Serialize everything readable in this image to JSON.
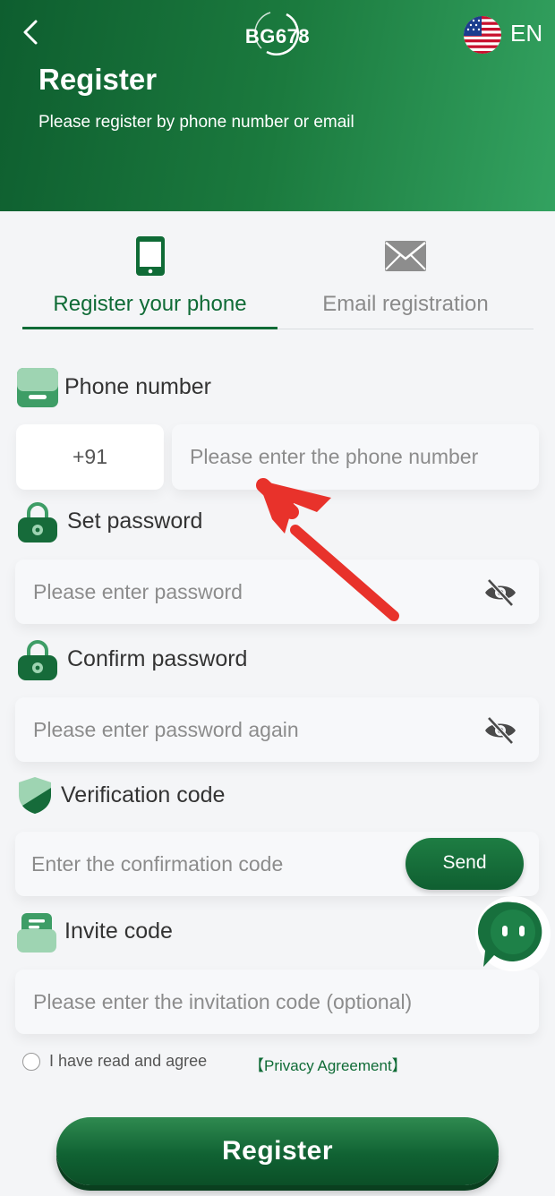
{
  "header": {
    "logo_text": "BG678",
    "language": "EN",
    "title": "Register",
    "subtitle": "Please register by phone number or email"
  },
  "tabs": [
    {
      "label": "Register your phone",
      "icon": "phone-icon",
      "active": true
    },
    {
      "label": "Email registration",
      "icon": "envelope-icon",
      "active": false
    }
  ],
  "form": {
    "phone": {
      "label": "Phone number",
      "country_code": "+91",
      "placeholder": "Please enter the phone number"
    },
    "password": {
      "label": "Set password",
      "placeholder": "Please enter password"
    },
    "confirm_password": {
      "label": "Confirm password",
      "placeholder": "Please enter password again"
    },
    "verification": {
      "label": "Verification code",
      "placeholder": "Enter the confirmation code",
      "send_label": "Send"
    },
    "invite": {
      "label": "Invite code",
      "placeholder": "Please enter the invitation code (optional)"
    },
    "agreement": {
      "text": "I have read and agree",
      "link": "【Privacy Agreement】"
    },
    "submit_label": "Register"
  },
  "colors": {
    "brand_green": "#0f6b36",
    "header_gradient_start": "#0e5e2f",
    "header_gradient_end": "#33a260",
    "annotation_red": "#e8322b"
  }
}
